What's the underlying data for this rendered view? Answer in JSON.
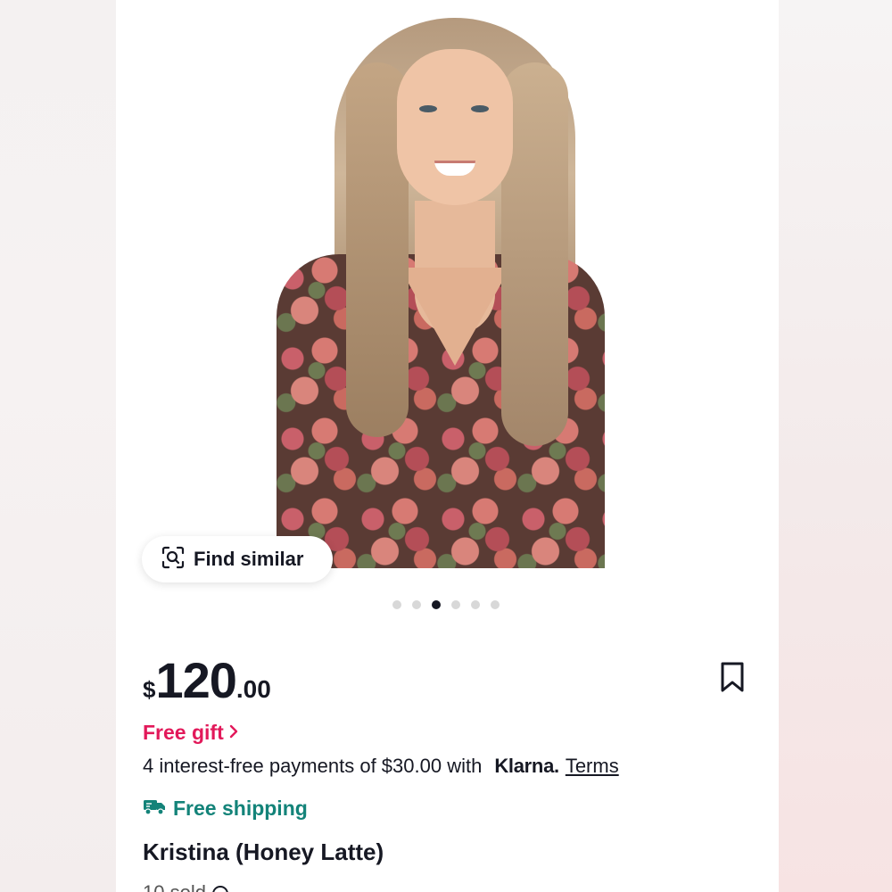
{
  "product": {
    "find_similar_label": "Find similar",
    "carousel": {
      "count": 6,
      "active_index": 2
    },
    "price": {
      "currency": "$",
      "whole": "120",
      "cents": ".00"
    },
    "free_gift_label": "Free gift",
    "payments_text": "4 interest-free payments of $30.00 with",
    "klarna_label": "Klarna.",
    "terms_label": "Terms",
    "free_shipping_label": "Free shipping",
    "title": "Kristina (Honey Latte)",
    "sold_text": "10 sold"
  },
  "colors": {
    "gift": "#e2195a",
    "shipping": "#138379",
    "text": "#161823"
  },
  "icons": [
    "search-similar-icon",
    "bookmark-icon",
    "chevron-right-icon",
    "truck-icon",
    "info-icon"
  ]
}
